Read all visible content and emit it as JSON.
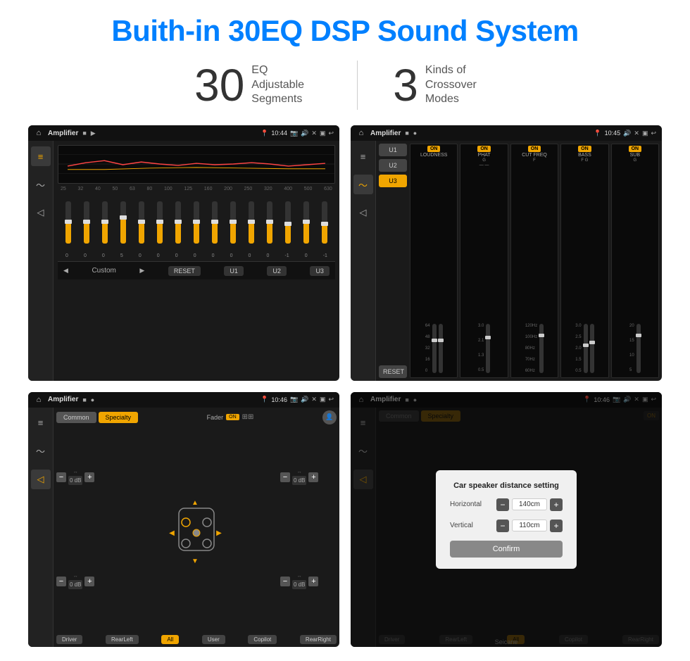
{
  "page": {
    "title": "Buith-in 30EQ DSP Sound System",
    "stats": [
      {
        "number": "30",
        "label": "EQ Adjustable\nSegments"
      },
      {
        "number": "3",
        "label": "Kinds of\nCrossover Modes"
      }
    ]
  },
  "screens": {
    "eq": {
      "status_bar": {
        "title": "Amplifier",
        "time": "10:44"
      },
      "freq_labels": [
        "25",
        "32",
        "40",
        "50",
        "63",
        "80",
        "100",
        "125",
        "160",
        "200",
        "250",
        "320",
        "400",
        "500",
        "630"
      ],
      "slider_values": [
        "0",
        "0",
        "0",
        "5",
        "0",
        "0",
        "0",
        "0",
        "0",
        "0",
        "0",
        "0",
        "-1",
        "0",
        "-1"
      ],
      "buttons": {
        "reset": "RESET",
        "u1": "U1",
        "u2": "U2",
        "u3": "U3",
        "custom": "Custom"
      }
    },
    "crossover": {
      "status_bar": {
        "title": "Amplifier",
        "time": "10:45"
      },
      "u_buttons": [
        "U1",
        "U2",
        "U3"
      ],
      "active_u": "U3",
      "reset_btn": "RESET",
      "channels": [
        {
          "name": "LOUDNESS",
          "on": true
        },
        {
          "name": "PHAT",
          "on": true
        },
        {
          "name": "CUT FREQ",
          "on": true
        },
        {
          "name": "BASS",
          "on": true
        },
        {
          "name": "SUB",
          "on": true
        }
      ]
    },
    "speaker": {
      "status_bar": {
        "title": "Amplifier",
        "time": "10:46"
      },
      "seg_buttons": [
        "Common",
        "Specialty"
      ],
      "active_seg": "Specialty",
      "fader_label": "Fader",
      "fader_on": "ON",
      "vol_controls": [
        {
          "id": "fl",
          "value": "0 dB"
        },
        {
          "id": "bl",
          "value": "0 dB"
        },
        {
          "id": "fr",
          "value": "0 dB"
        },
        {
          "id": "br",
          "value": "0 dB"
        }
      ],
      "position_buttons": [
        "Driver",
        "RearLeft",
        "All",
        "User",
        "Copilot",
        "RearRight"
      ]
    },
    "distance": {
      "status_bar": {
        "title": "Amplifier",
        "time": "10:46"
      },
      "seg_buttons": [
        "Common",
        "Specialty"
      ],
      "active_seg": "Specialty",
      "dialog": {
        "title": "Car speaker distance setting",
        "horizontal_label": "Horizontal",
        "horizontal_value": "140cm",
        "vertical_label": "Vertical",
        "vertical_value": "110cm",
        "confirm_btn": "Confirm"
      },
      "position_buttons": [
        "Driver",
        "RearLeft",
        "All",
        "User",
        "Copilot",
        "RearRight"
      ]
    }
  },
  "watermark": "Seicane"
}
